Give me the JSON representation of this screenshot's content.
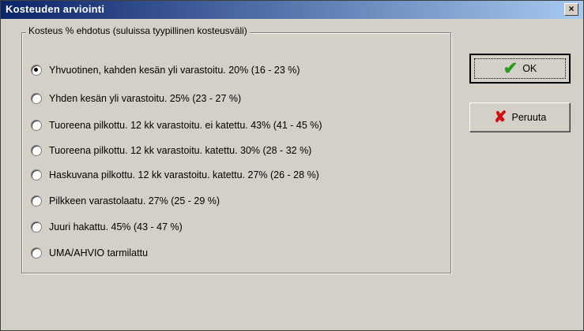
{
  "window": {
    "title": "Kosteuden arviointi",
    "close_glyph": "×"
  },
  "group": {
    "legend": "Kosteus % ehdotus (suluissa tyypillinen kosteusväli)",
    "selected_index": 0,
    "options": [
      "Yhvuotinen, kahden kesän yli varastoitu. 20% (16 - 23 %)",
      "Yhden kesän yli varastoitu. 25% (23 - 27 %)",
      "Tuoreena pilkottu. 12 kk varastoitu. ei katettu. 43% (41 - 45 %)",
      "Tuoreena pilkottu. 12 kk varastoitu. katettu. 30% (28 - 32 %)",
      "Haskuvana pilkottu. 12 kk varastoitu. katettu. 27% (26 - 28 %)",
      "Pilkkeen varastolaatu. 27% (25 - 29 %)",
      "Juuri hakattu. 45% (43 - 47 %)",
      "UMA/AHVIO tarmilattu"
    ]
  },
  "buttons": {
    "ok": {
      "label": "OK",
      "icon": "check-icon",
      "color": "#2a9a1a"
    },
    "cancel": {
      "label": "Peruuta",
      "icon": "x-icon",
      "color": "#d01010"
    }
  }
}
